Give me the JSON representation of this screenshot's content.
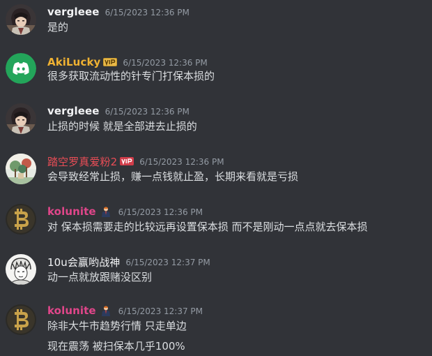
{
  "messages": [
    {
      "author": "vergleee",
      "author_color": "#f2f3f5",
      "avatar_icon": "anime-character-avatar-icon",
      "timestamp": "6/15/2023 12:36 PM",
      "lines": [
        "是的"
      ]
    },
    {
      "author": "AkiLucky",
      "author_color": "#f0b232",
      "avatar_icon": "discord-logo-icon",
      "badge_icon": "vip-badge-icon",
      "timestamp": "6/15/2023 12:36 PM",
      "lines": [
        "很多获取流动性的针专门打保本损的"
      ]
    },
    {
      "author": "vergleee",
      "author_color": "#f2f3f5",
      "avatar_icon": "anime-character-avatar-icon",
      "timestamp": "6/15/2023 12:36 PM",
      "lines": [
        "止损的时候 就是全部进去止损的"
      ]
    },
    {
      "author": "踏空罗真爱粉2",
      "author_color": "#e94d56",
      "avatar_icon": "landscape-avatar-icon",
      "badge_icon": "vip-badge-icon",
      "timestamp": "6/15/2023 12:36 PM",
      "lines": [
        "会导致经常止损，赚一点钱就止盈，长期来看就是亏损"
      ]
    },
    {
      "author": "kolunite",
      "author_color": "#e0468a",
      "avatar_icon": "bitcoin-coin-avatar-icon",
      "badge_icon": "person-badge-icon",
      "timestamp": "6/15/2023 12:36 PM",
      "lines": [
        "对 保本损需要走的比较远再设置保本损 而不是刚动一点点就去保本损"
      ]
    },
    {
      "author": "10u会赢哟战神",
      "author_color": "#f2f3f5",
      "avatar_icon": "sketch-character-avatar-icon",
      "timestamp": "6/15/2023 12:37 PM",
      "lines": [
        "动一点就放跟赌没区别"
      ]
    },
    {
      "author": "kolunite",
      "author_color": "#e0468a",
      "avatar_icon": "bitcoin-coin-avatar-icon",
      "badge_icon": "person-badge-icon",
      "timestamp": "6/15/2023 12:37 PM",
      "lines": [
        "除非大牛市趋势行情 只走单边",
        "现在震荡 被扫保本几乎100%"
      ]
    }
  ]
}
